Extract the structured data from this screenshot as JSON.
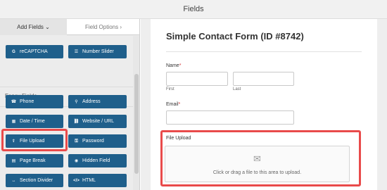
{
  "header": {
    "title": "Fields"
  },
  "sidebar": {
    "tabs": {
      "add_fields": "Add Fields",
      "add_fields_chevron": "⌄",
      "field_options": "Field Options",
      "field_options_chevron": "›"
    },
    "top_fields": [
      {
        "label": "reCAPTCHA",
        "icon": "G"
      },
      {
        "label": "Number Slider",
        "icon": "☰"
      }
    ],
    "fancy_section": {
      "title": "Fancy Fields",
      "chevron": "⌄"
    },
    "fancy_fields": [
      {
        "label": "Phone",
        "icon": "☎"
      },
      {
        "label": "Address",
        "icon": "⚲"
      },
      {
        "label": "Date / Time",
        "icon": "▦"
      },
      {
        "label": "Website / URL",
        "icon": "⛓"
      },
      {
        "label": "File Upload",
        "icon": "⇪"
      },
      {
        "label": "Password",
        "icon": "⚿"
      },
      {
        "label": "Page Break",
        "icon": "▤"
      },
      {
        "label": "Hidden Field",
        "icon": "◉"
      },
      {
        "label": "Section Divider",
        "icon": "↔"
      },
      {
        "label": "HTML",
        "icon": "</>"
      }
    ]
  },
  "form": {
    "title": "Simple Contact Form (ID #8742)",
    "name_label": "Name",
    "required_marker": "*",
    "first_label": "First",
    "last_label": "Last",
    "email_label": "Email",
    "file_upload_label": "File Upload",
    "upload_icon": "✉",
    "upload_text": "Click or drag a file to this area to upload."
  },
  "colors": {
    "button_bg": "#1f5f8b",
    "highlight": "#e94b4b",
    "required": "#d63638"
  }
}
